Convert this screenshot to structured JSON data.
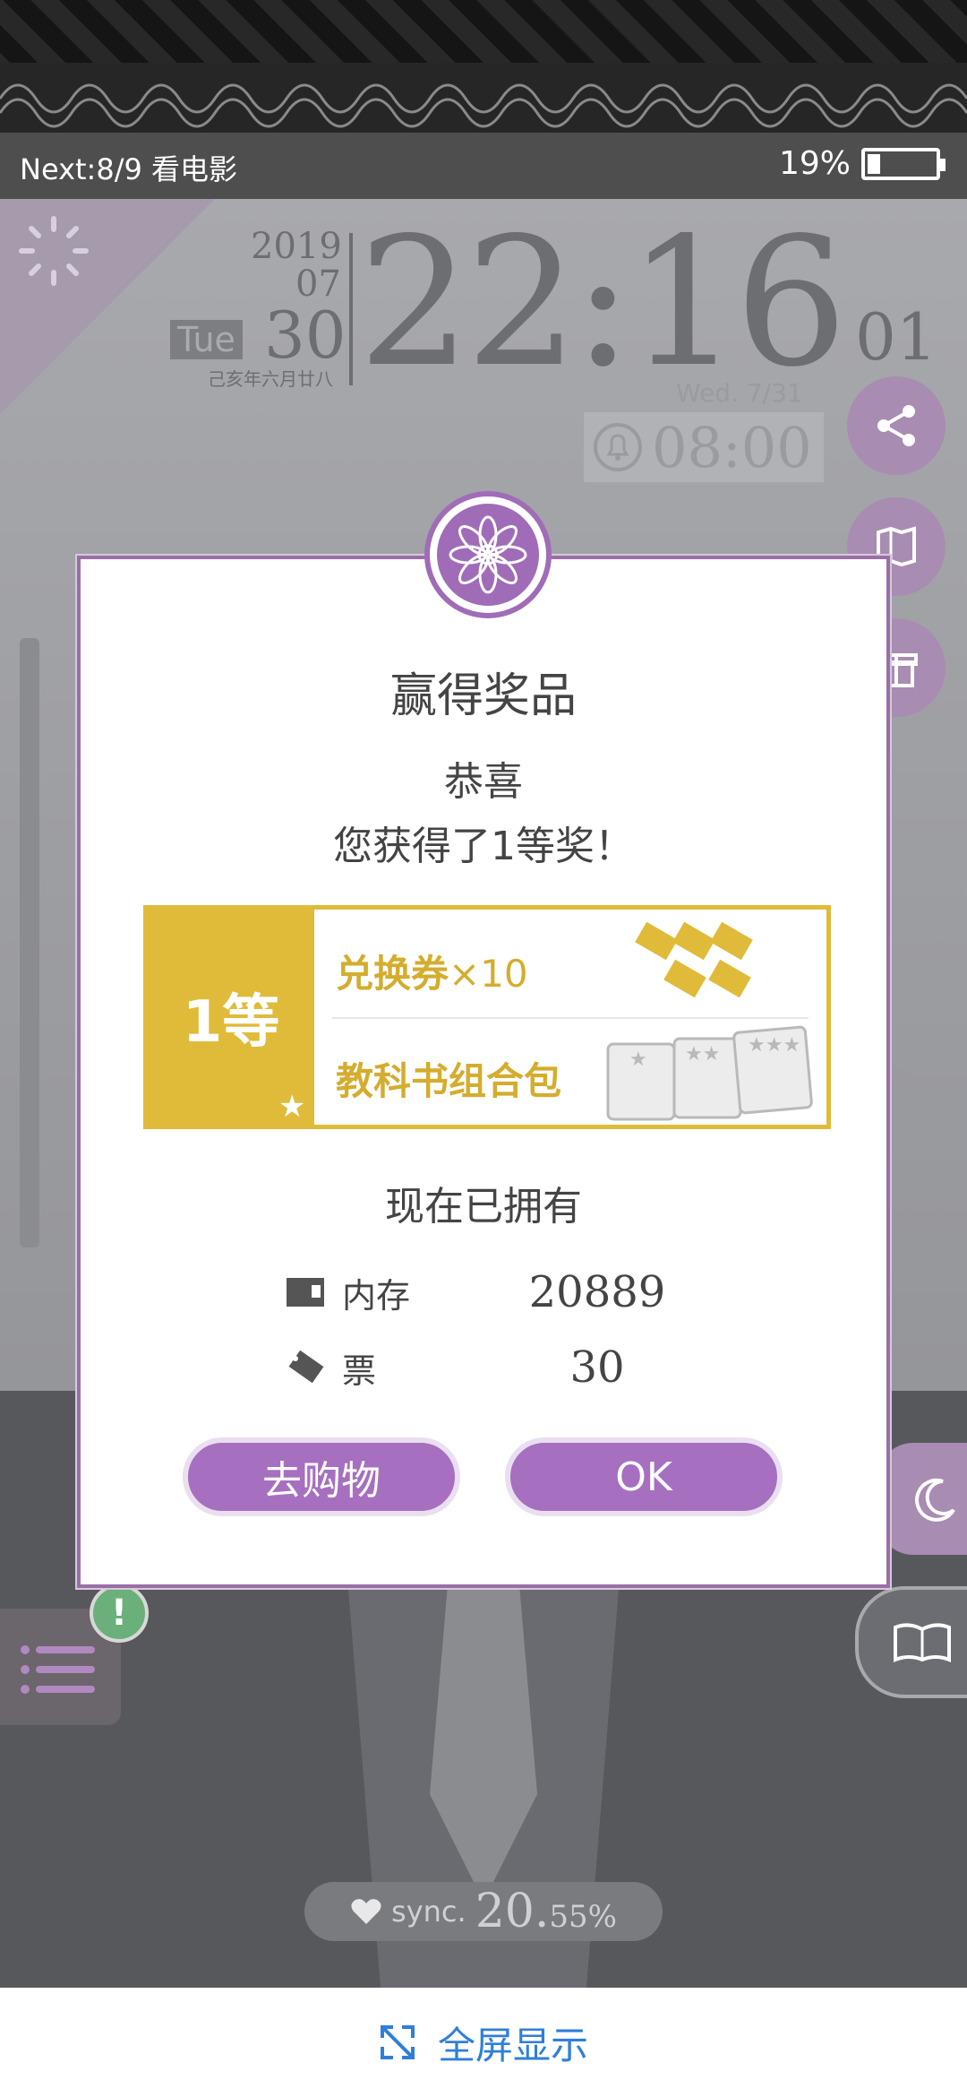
{
  "status_bar": {
    "next_event": "Next:8/9 看电影",
    "battery_percent": "19%",
    "battery_level": 0.19
  },
  "clock": {
    "year": "2019",
    "month": "07",
    "weekday": "Tue",
    "day": "30",
    "lunar_date": "己亥年六月廿八",
    "time": "22:16",
    "seconds": "01",
    "next_alarm_date": "Wed.  7/31",
    "alarm_time": "08:00"
  },
  "dialog": {
    "title": "赢得奖品",
    "congrats": "恭喜",
    "message": "您获得了1等奖！",
    "prize": {
      "rank": "1等",
      "item1_name": "兑换券",
      "item1_qty": "×10",
      "item2_name": "教科书组合包"
    },
    "owned_heading": "现在已拥有",
    "owned": [
      {
        "name": "内存",
        "value": "20889"
      },
      {
        "name": "票",
        "value": "30"
      }
    ],
    "shop_button": "去购物",
    "ok_button": "OK"
  },
  "sync": {
    "label": "sync.",
    "value_int": "20.",
    "value_frac": "55%"
  },
  "bottom_bar": {
    "fullscreen_label": "全屏显示"
  },
  "colors": {
    "accent_purple": "#a66fc0",
    "prize_gold": "#e0bb3a",
    "link_blue": "#2f7fd8"
  }
}
